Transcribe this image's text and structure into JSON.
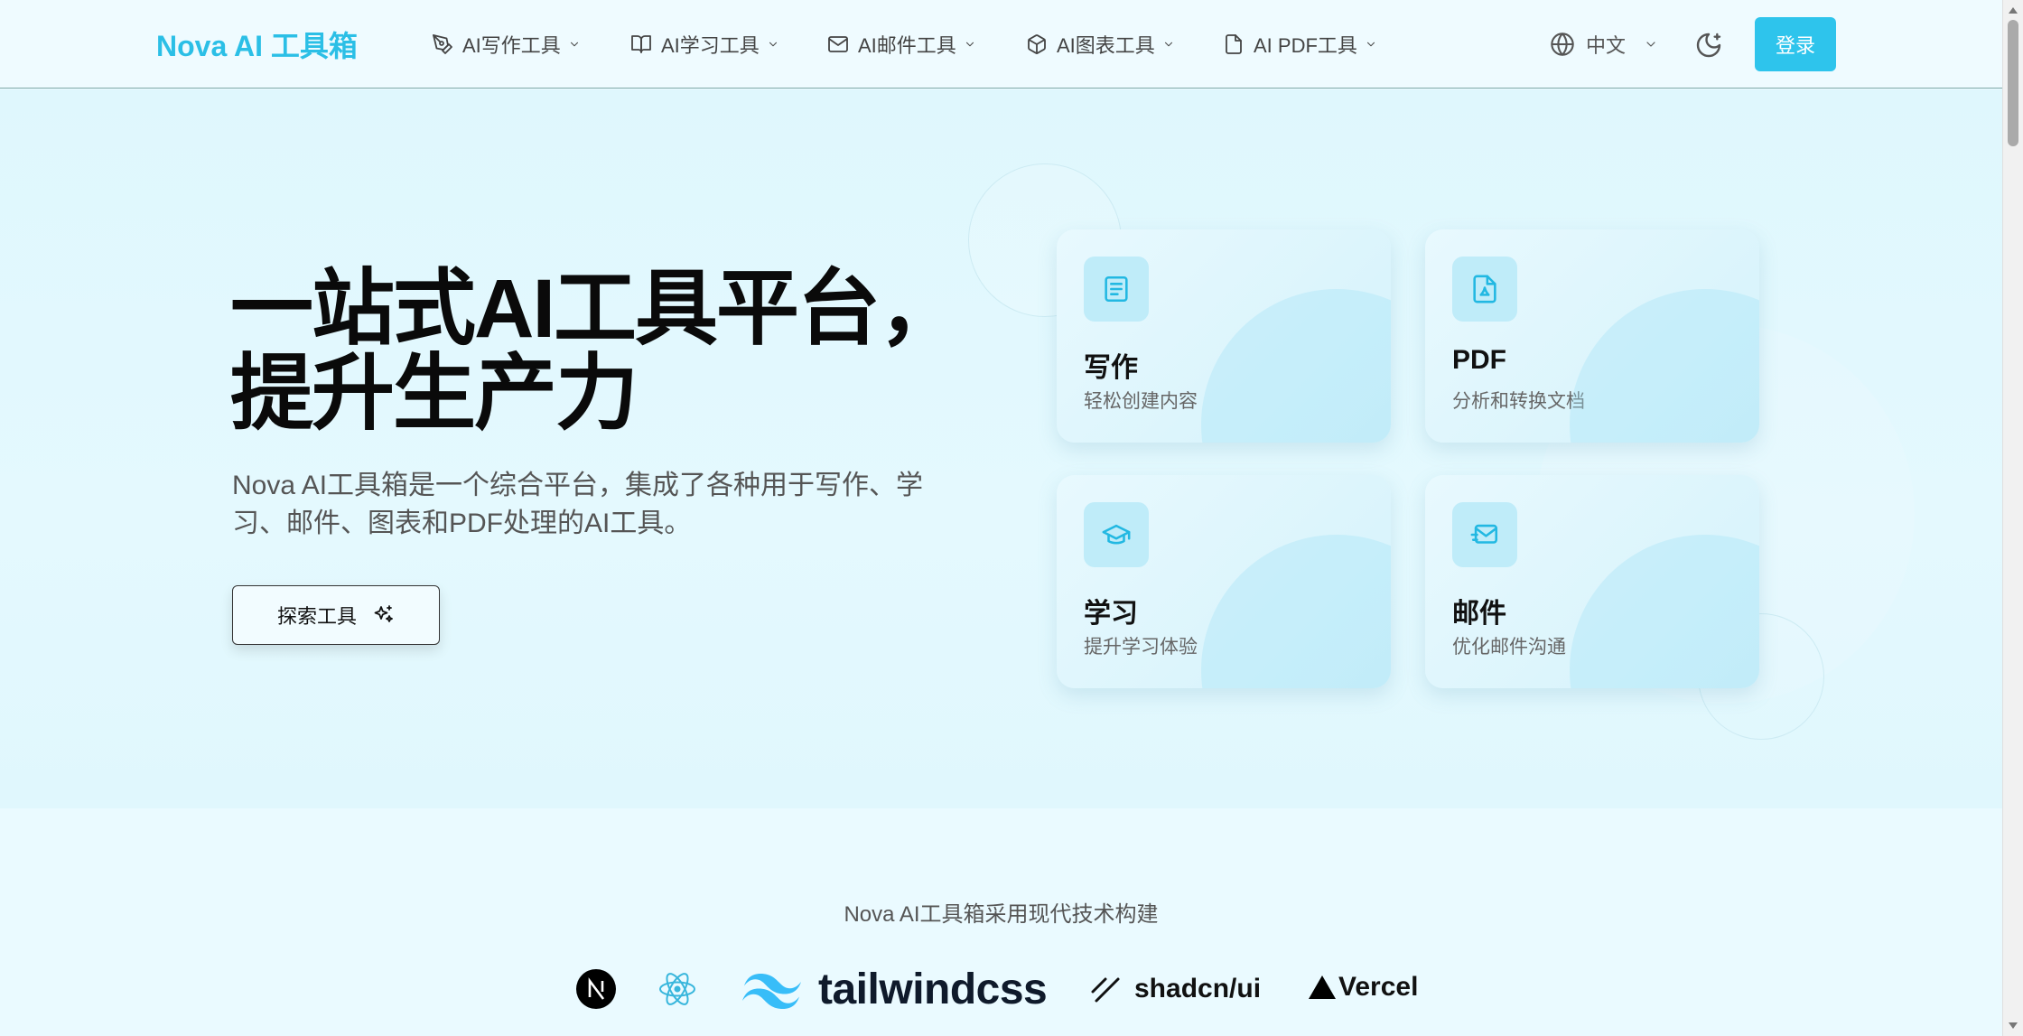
{
  "header": {
    "logo": "Nova AI 工具箱",
    "nav": [
      {
        "label": "AI写作工具",
        "icon": "pen-tool-icon"
      },
      {
        "label": "AI学习工具",
        "icon": "book-open-icon"
      },
      {
        "label": "AI邮件工具",
        "icon": "mail-icon"
      },
      {
        "label": "AI图表工具",
        "icon": "box-icon"
      },
      {
        "label": "AI PDF工具",
        "icon": "file-icon"
      }
    ],
    "language": "中文",
    "login_label": "登录"
  },
  "hero": {
    "title_line1": "一站式AI工具平台，",
    "title_line2": "提升生产力",
    "subtitle": "Nova AI工具箱是一个综合平台，集成了各种用于写作、学习、邮件、图表和PDF处理的AI工具。",
    "explore_label": "探索工具",
    "cards": [
      {
        "title": "写作",
        "desc": "轻松创建内容",
        "icon": "document-text-icon"
      },
      {
        "title": "PDF",
        "desc": "分析和转换文档",
        "icon": "file-pdf-icon"
      },
      {
        "title": "学习",
        "desc": "提升学习体验",
        "icon": "graduation-cap-icon"
      },
      {
        "title": "邮件",
        "desc": "优化邮件沟通",
        "icon": "mail-send-icon"
      }
    ]
  },
  "tech": {
    "caption": "Nova AI工具箱采用现代技术构建",
    "logos": [
      "nextjs-logo",
      "react-logo",
      "tailwindcss",
      "shadcn/ui",
      "Vercel"
    ],
    "tailwind_label": "tailwindcss",
    "shadcn_label": "shadcn/ui",
    "vercel_label": "Vercel"
  },
  "colors": {
    "accent": "#2ec4ec",
    "logo": "#2bbfe6",
    "background": "#e4f9fe"
  }
}
